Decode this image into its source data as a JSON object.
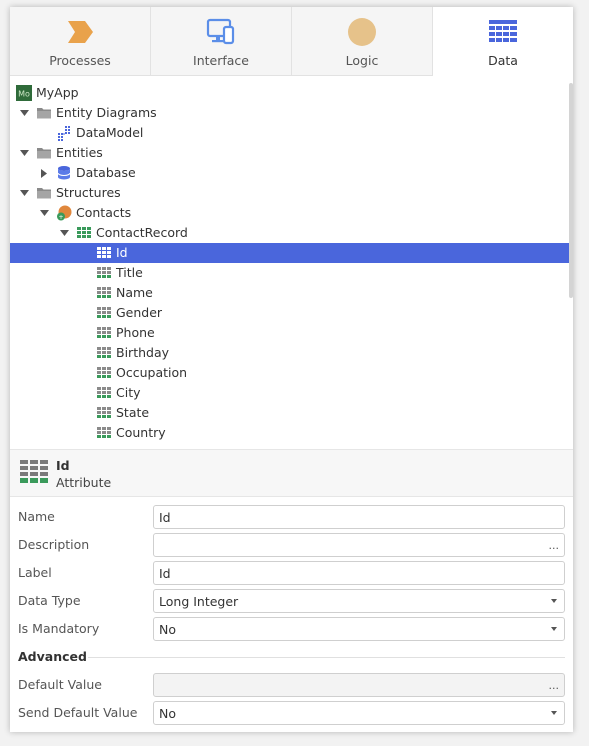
{
  "tabs": [
    {
      "label": "Processes",
      "icon": "processes-icon",
      "color": "#e9a24b"
    },
    {
      "label": "Interface",
      "icon": "interface-icon",
      "color": "#5b8ee8"
    },
    {
      "label": "Logic",
      "icon": "logic-icon",
      "color": "#e6c28a"
    },
    {
      "label": "Data",
      "icon": "data-icon",
      "color": "#4a66dc",
      "active": true
    }
  ],
  "tree": [
    {
      "label": "MyApp",
      "icon": "app-icon",
      "level": 0,
      "toggle": "none"
    },
    {
      "label": "Entity Diagrams",
      "icon": "folder-icon",
      "level": 0,
      "toggle": "expanded"
    },
    {
      "label": "DataModel",
      "icon": "diagram-icon",
      "level": 1,
      "toggle": "none"
    },
    {
      "label": "Entities",
      "icon": "folder-icon",
      "level": 0,
      "toggle": "expanded"
    },
    {
      "label": "Database",
      "icon": "database-icon",
      "level": 1,
      "toggle": "collapsed"
    },
    {
      "label": "Structures",
      "icon": "folder-icon",
      "level": 0,
      "toggle": "expanded"
    },
    {
      "label": "Contacts",
      "icon": "structure-module-icon",
      "level": 1,
      "toggle": "expanded"
    },
    {
      "label": "ContactRecord",
      "icon": "record-icon",
      "level": 2,
      "toggle": "expanded"
    },
    {
      "label": "Id",
      "icon": "attribute-icon",
      "level": 3,
      "toggle": "none",
      "selected": true
    },
    {
      "label": "Title",
      "icon": "attribute-icon",
      "level": 3,
      "toggle": "none"
    },
    {
      "label": "Name",
      "icon": "attribute-icon",
      "level": 3,
      "toggle": "none"
    },
    {
      "label": "Gender",
      "icon": "attribute-icon",
      "level": 3,
      "toggle": "none"
    },
    {
      "label": "Phone",
      "icon": "attribute-icon",
      "level": 3,
      "toggle": "none"
    },
    {
      "label": "Birthday",
      "icon": "attribute-icon",
      "level": 3,
      "toggle": "none"
    },
    {
      "label": "Occupation",
      "icon": "attribute-icon",
      "level": 3,
      "toggle": "none"
    },
    {
      "label": "City",
      "icon": "attribute-icon",
      "level": 3,
      "toggle": "none"
    },
    {
      "label": "State",
      "icon": "attribute-icon",
      "level": 3,
      "toggle": "none"
    },
    {
      "label": "Country",
      "icon": "attribute-icon",
      "level": 3,
      "toggle": "none"
    }
  ],
  "selection": {
    "name": "Id",
    "type": "Attribute"
  },
  "properties": {
    "name": {
      "label": "Name",
      "value": "Id"
    },
    "description": {
      "label": "Description",
      "value": "",
      "button": "..."
    },
    "label": {
      "label": "Label",
      "value": "Id"
    },
    "data_type": {
      "label": "Data Type",
      "value": "Long Integer"
    },
    "is_mandatory": {
      "label": "Is Mandatory",
      "value": "No"
    },
    "advanced_heading": "Advanced",
    "default_value": {
      "label": "Default Value",
      "value": "",
      "button": "..."
    },
    "send_default_value": {
      "label": "Send Default Value",
      "value": "No"
    }
  },
  "colors": {
    "selection": "#4a66dc",
    "attribute_green": "#3a9a5b"
  }
}
